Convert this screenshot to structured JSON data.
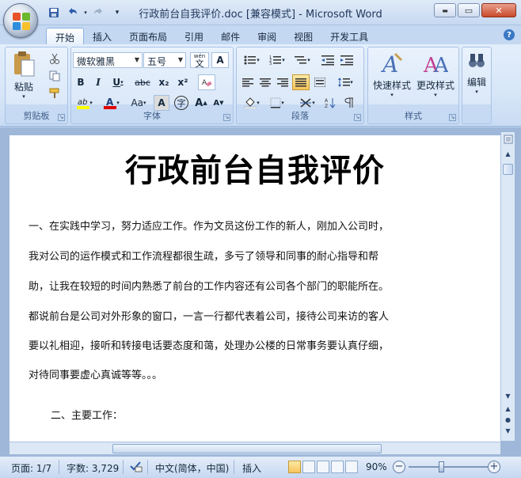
{
  "window": {
    "title": "行政前台自我评价.doc [兼容模式] - Microsoft Word",
    "min_label": "▬",
    "max_label": "▭",
    "close_label": "✕"
  },
  "tabs": [
    {
      "label": "开始",
      "active": true
    },
    {
      "label": "插入"
    },
    {
      "label": "页面布局"
    },
    {
      "label": "引用"
    },
    {
      "label": "邮件"
    },
    {
      "label": "审阅"
    },
    {
      "label": "视图"
    },
    {
      "label": "开发工具"
    }
  ],
  "ribbon": {
    "clipboard": {
      "paste_label": "粘贴",
      "group_label": "剪贴板"
    },
    "font": {
      "font_name": "微软雅黑",
      "font_size": "五号",
      "group_label": "字体",
      "bold": "B",
      "italic": "I",
      "underline": "U",
      "strike": "abc",
      "subscript": "x₂",
      "superscript": "x²",
      "change_case": "Aa",
      "grow": "A",
      "shrink": "A",
      "wen": "wén",
      "char_border": "A",
      "char_shading": "A",
      "enclose": "字"
    },
    "paragraph": {
      "group_label": "段落"
    },
    "styles": {
      "quick_styles_label": "快速样式",
      "change_styles_label": "更改样式",
      "group_label": "样式"
    },
    "editing": {
      "label": "编辑"
    }
  },
  "document": {
    "title": "行政前台自我评价",
    "lines": [
      "一、在实践中学习，努力适应工作。作为文员这份工作的新人，刚加入公司时，",
      "我对公司的运作模式和工作流程都很生疏，多亏了领导和同事的耐心指导和帮",
      "助，让我在较短的时间内熟悉了前台的工作内容还有公司各个部门的职能所在。",
      "都说前台是公司对外形象的窗口，一言一行都代表着公司，接待公司来访的客人",
      "要以礼相迎，接听和转接电话要态度和蔼，处理办公楼的日常事务要认真仔细，",
      "对待同事要虚心真诚等等。。。"
    ],
    "heading2": "二、主要工作："
  },
  "statusbar": {
    "page": "页面: 1/7",
    "words": "字数: 3,729",
    "language": "中文(简体，中国)",
    "mode": "插入",
    "zoom": "90%",
    "zoom_minus": "−",
    "zoom_plus": "+"
  },
  "colors": {
    "highlight": "#ffff00",
    "font_color": "#e00000",
    "accent": "#3b78c6"
  }
}
